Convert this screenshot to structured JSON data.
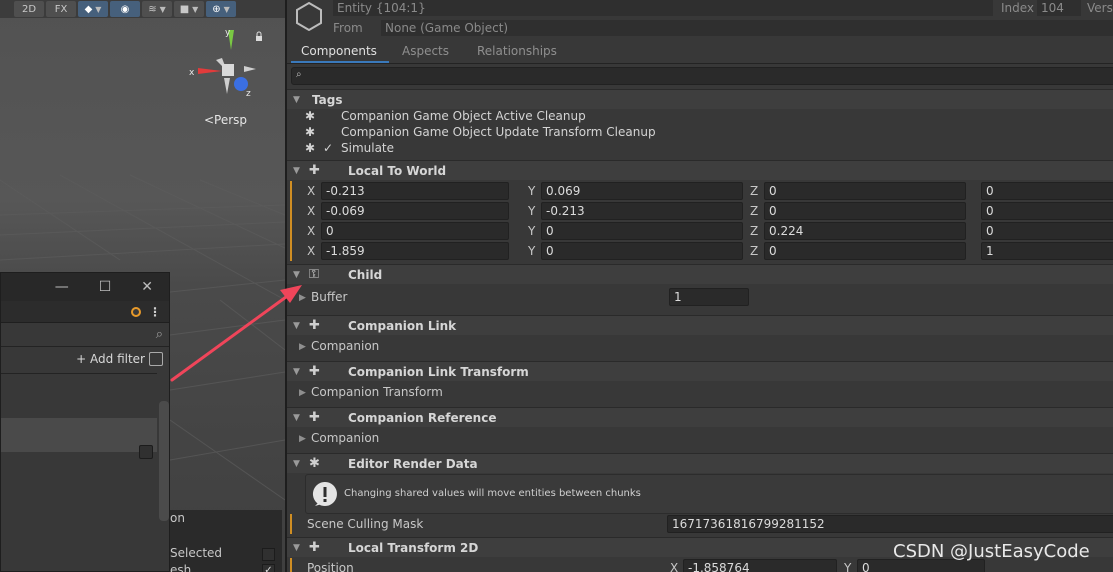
{
  "scene": {
    "toolbar": {
      "btn_2d": "2D",
      "btn_fx": "FX",
      "btn_gizmo_arrow": "▾"
    },
    "gizmo": {
      "x": "x",
      "y": "y",
      "z": "z"
    },
    "persp_label": "<Persp"
  },
  "floating_window": {
    "add_filter": "+ Add filter",
    "sub_panel": {
      "line1": "on",
      "line2": "Selected",
      "line3": "esh"
    }
  },
  "inspector": {
    "header": {
      "entity": "Entity {104:1}",
      "from_label": "From",
      "from_value": "None (Game Object)",
      "index_label": "Index",
      "index_value": "104",
      "version_label": "Vers"
    },
    "tabs": [
      "Components",
      "Aspects",
      "Relationships"
    ],
    "active_tab": "Components",
    "sections": {
      "tags": {
        "title": "Tags",
        "items": [
          "Companion Game Object Active Cleanup",
          "Companion Game Object Update Transform Cleanup",
          "Simulate"
        ]
      },
      "local_to_world": {
        "title": "Local To World",
        "rows": [
          {
            "x": "-0.213",
            "y": "0.069",
            "z": "0",
            "w": "0"
          },
          {
            "x": "-0.069",
            "y": "-0.213",
            "z": "0",
            "w": "0"
          },
          {
            "x": "0",
            "y": "0",
            "z": "0.224",
            "w": "0"
          },
          {
            "x": "-1.859",
            "y": "0",
            "z": "0",
            "w": "1"
          }
        ],
        "axis_labels": {
          "x": "X",
          "y": "Y",
          "z": "Z"
        }
      },
      "child": {
        "title": "Child",
        "buffer_label": "Buffer",
        "buffer_value": "1"
      },
      "companion_link": {
        "title": "Companion Link",
        "field": "Companion"
      },
      "companion_link_transform": {
        "title": "Companion Link Transform",
        "field": "Companion Transform"
      },
      "companion_reference": {
        "title": "Companion Reference",
        "field": "Companion"
      },
      "editor_render_data": {
        "title": "Editor Render Data",
        "warning": "Changing shared values will move entities between chunks"
      },
      "scene_culling": {
        "label": "Scene Culling Mask",
        "value": "16717361816799281152"
      },
      "local_transform_2d": {
        "title": "Local Transform 2D",
        "position_label": "Position",
        "x_label": "X",
        "x_value": "-1.858764",
        "y_label": "Y",
        "y_value": "0"
      }
    }
  },
  "watermark": "CSDN @JustEasyCode",
  "colors": {
    "accent_blue": "#3a79bb",
    "modified_bar": "#d08e23",
    "arrow_red": "#f0455a"
  }
}
